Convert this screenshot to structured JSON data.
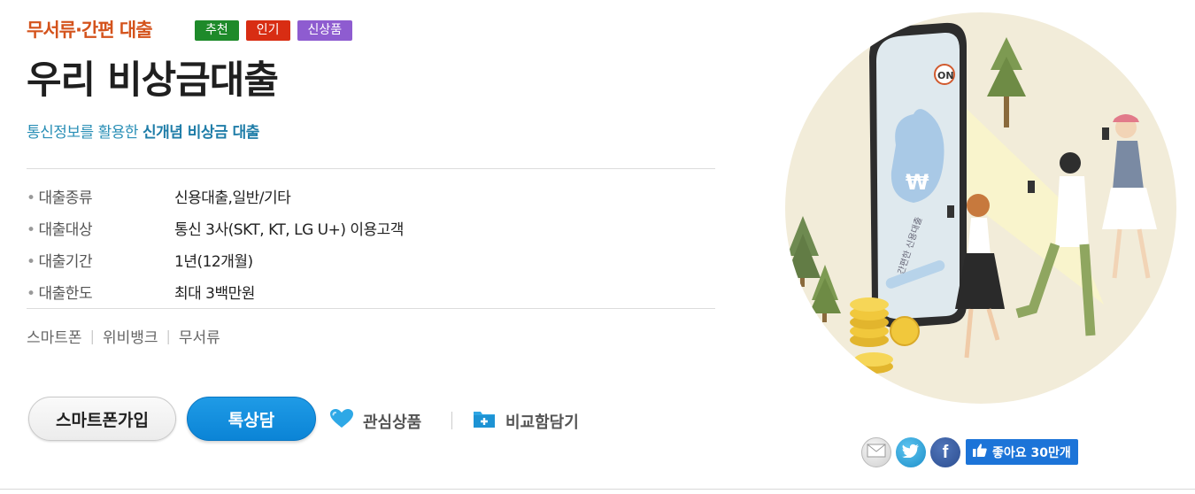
{
  "header": {
    "category": "무서류·간편 대출",
    "badges": [
      "추천",
      "인기",
      "신상품"
    ]
  },
  "product": {
    "title": "우리 비상금대출",
    "subtitle_prefix": "통신정보를 활용한 ",
    "subtitle_emphasis": "신개념 비상금 대출"
  },
  "specs": [
    {
      "key": "대출종류",
      "value": "신용대출,일반/기타"
    },
    {
      "key": "대출대상",
      "value": "통신 3사(SKT, KT, LG U+) 이용고객"
    },
    {
      "key": "대출기간",
      "value": "1년(12개월)"
    },
    {
      "key": "대출한도",
      "value": "최대 3백만원"
    }
  ],
  "tags": [
    "스마트폰",
    "위비뱅크",
    "무서류"
  ],
  "buttons": {
    "smartphone_join": "스마트폰가입",
    "talk_consult": "톡상담",
    "favorite": "관심상품",
    "compare": "비교함담기"
  },
  "illustration": {
    "phone_switch": "ON",
    "phone_text": "간편한 신용대출",
    "bag_symbol": "₩"
  },
  "social": {
    "like_label": "좋아요 30만개",
    "icons": [
      "mail-icon",
      "twitter-icon",
      "facebook-icon",
      "thumbs-up-icon"
    ]
  },
  "colors": {
    "category": "#d4531c",
    "badge_rec": "#1e8a2a",
    "badge_pop": "#d82d13",
    "badge_new": "#8e5cd0",
    "subtitle": "#2a8fb6",
    "talk_button": "#0b84d6",
    "like_button": "#1c74d8"
  }
}
